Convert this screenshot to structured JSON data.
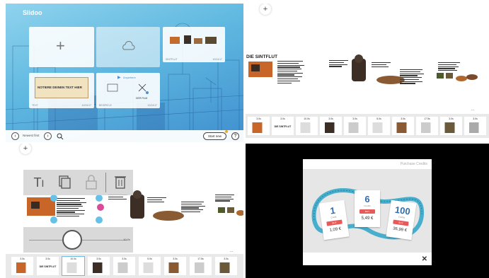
{
  "panel_home": {
    "app_logo": "Slidoo",
    "tiles": [
      {
        "caption_left": "",
        "caption_right": ""
      },
      {
        "caption_left": "",
        "caption_right": ""
      },
      {
        "caption_left": "SINTFLUT",
        "caption_right": "10/24/17"
      },
      {
        "caption_left": "TEXT",
        "caption_right": "10/24/17",
        "note_text": "NOTIERE DEINEN TEXT HIER"
      },
      {
        "caption_left": "BEISPIELE",
        "caption_right": "10/24/17",
        "note_text": "Anywhere",
        "label_b": "DER FILM"
      }
    ],
    "nav_label": "Newest first",
    "start_button": "Start new",
    "help_glyph": "?"
  },
  "panel_story": {
    "story_title": "DIE SINTFLUT",
    "frames": [
      {
        "dur": "3.0s",
        "text": ""
      },
      {
        "dur": "3.0s",
        "text": "DIE SINTFLUT"
      },
      {
        "dur": "10.0s",
        "text": ""
      },
      {
        "dur": "3.0s",
        "text": ""
      },
      {
        "dur": "3.0s",
        "text": ""
      },
      {
        "dur": "5.0s",
        "text": ""
      },
      {
        "dur": "3.0s",
        "text": ""
      },
      {
        "dur": "17.5s",
        "text": ""
      },
      {
        "dur": "3.0s",
        "text": ""
      },
      {
        "dur": "3.0s",
        "text": ""
      }
    ],
    "ellipsis": "..."
  },
  "panel_edit": {
    "slider_value": "10.0s",
    "frames": [
      {
        "dur": "3.0s",
        "text": ""
      },
      {
        "dur": "3.0s",
        "text": "DIE SINTFLUT"
      },
      {
        "dur": "10.0s",
        "text": ""
      },
      {
        "dur": "3.0s",
        "text": ""
      },
      {
        "dur": "3.0s",
        "text": ""
      },
      {
        "dur": "5.0s",
        "text": ""
      },
      {
        "dur": "3.0s",
        "text": ""
      },
      {
        "dur": "17.5s",
        "text": ""
      },
      {
        "dur": "3.0s",
        "text": ""
      }
    ],
    "ellipsis": "..."
  },
  "panel_purchase": {
    "title": "Purchase Credits",
    "cards": [
      {
        "num": "1",
        "sub": "Credit",
        "buy": "BUY",
        "price": "1,09 €"
      },
      {
        "num": "6",
        "sub": "Credits",
        "buy": "BUY",
        "price": "5,49 €"
      },
      {
        "num": "100",
        "sub": "Credits",
        "buy": "BUY",
        "price": "36,99 €"
      }
    ],
    "close": "✕"
  },
  "colors": {
    "accent_blue": "#66c1e8",
    "accent_pink": "#d94a9a",
    "buy_red": "#e85a5a",
    "ribbon_teal": "#2aa4c8"
  }
}
